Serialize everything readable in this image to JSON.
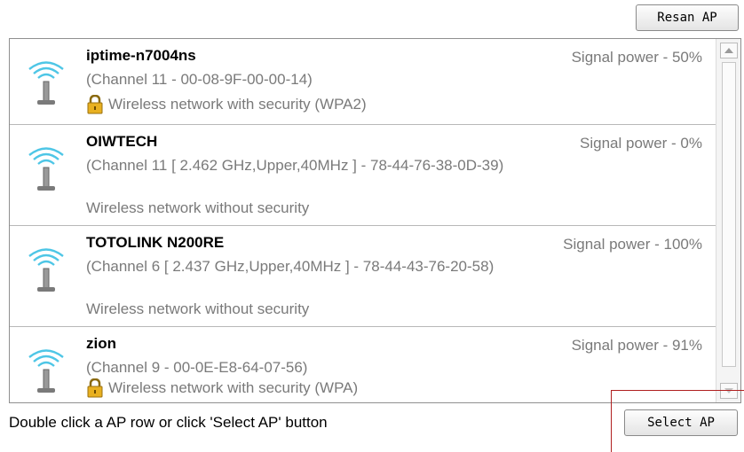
{
  "toolbar": {
    "rescan_label": "Resan AP"
  },
  "networks": [
    {
      "ssid": "iptime-n7004ns",
      "detail": "(Channel 11 - 00-08-9F-00-00-14)",
      "security": "Wireless network with security (WPA2)",
      "secured": true,
      "signal": "Signal power - 50%"
    },
    {
      "ssid": "OIWTECH",
      "detail": "(Channel 11 [ 2.462 GHz,Upper,40MHz ] - 78-44-76-38-0D-39)",
      "security": "Wireless network without security",
      "secured": false,
      "signal": "Signal power - 0%"
    },
    {
      "ssid": "TOTOLINK N200RE",
      "detail": "(Channel 6 [ 2.437 GHz,Upper,40MHz ] - 78-44-43-76-20-58)",
      "security": "Wireless network without security",
      "secured": false,
      "signal": "Signal power - 100%"
    },
    {
      "ssid": "zion",
      "detail": "(Channel 9 - 00-0E-E8-64-07-56)",
      "security": "Wireless network with security (WPA)",
      "secured": true,
      "signal": "Signal power - 91%"
    }
  ],
  "footer": {
    "hint": "Double click a AP row or click 'Select AP' button",
    "select_label": "Select AP"
  },
  "colors": {
    "wifi_icon": "#4ec6e6",
    "lock": "#e8b020",
    "highlight_box": "#b02020"
  }
}
